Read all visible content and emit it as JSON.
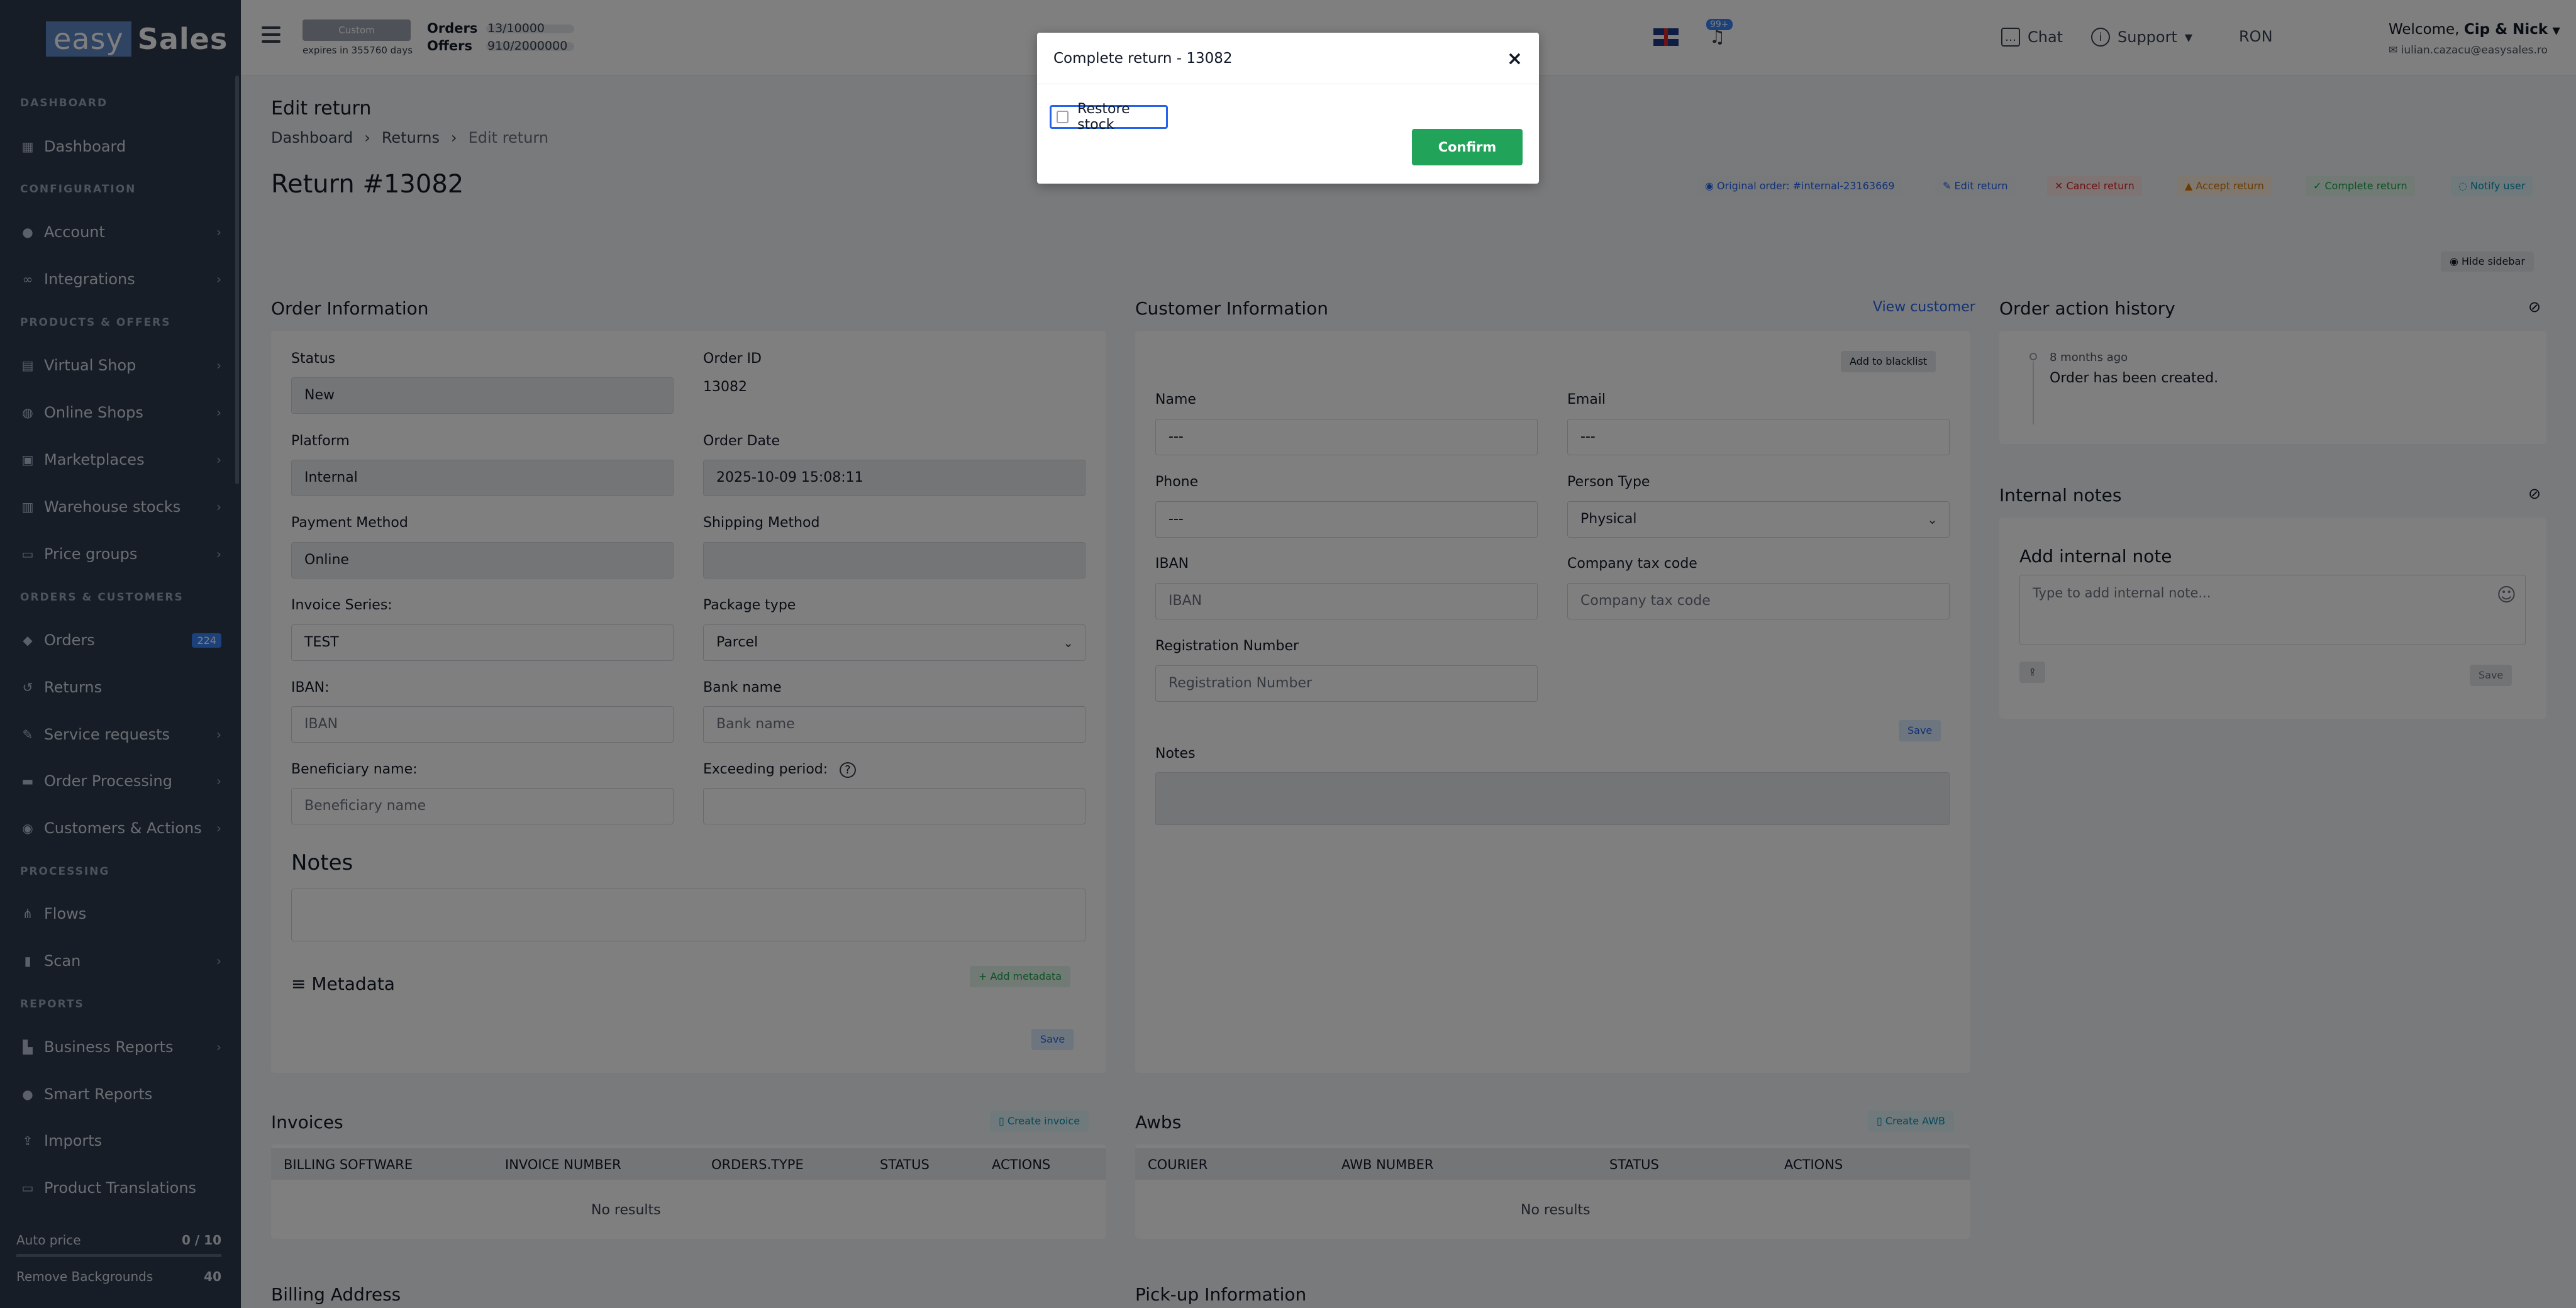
{
  "sidebar": {
    "logo": {
      "easy": "easy",
      "sales": "Sales"
    },
    "sections": {
      "dashboard": "DASHBOARD",
      "configuration": "CONFIGURATION",
      "products_offers": "PRODUCTS & OFFERS",
      "orders_customers": "ORDERS & CUSTOMERS",
      "processing": "PROCESSING",
      "reports": "REPORTS"
    },
    "items": {
      "dashboard": "Dashboard",
      "account": "Account",
      "integrations": "Integrations",
      "virtual_shop": "Virtual Shop",
      "online_shops": "Online Shops",
      "marketplaces": "Marketplaces",
      "warehouse_stocks": "Warehouse stocks",
      "price_groups": "Price groups",
      "orders": "Orders",
      "orders_badge": "224",
      "returns": "Returns",
      "service_requests": "Service requests",
      "order_processing": "Order Processing",
      "customers_actions": "Customers & Actions",
      "flows": "Flows",
      "scan": "Scan",
      "business_reports": "Business Reports",
      "smart_reports": "Smart Reports",
      "imports": "Imports",
      "product_translations": "Product Translations"
    },
    "usage": {
      "auto_price_label": "Auto price",
      "auto_price_value": "0 / 10",
      "auto_price_fraction": 0,
      "remove_bg_label": "Remove Backgrounds",
      "remove_bg_value": "40"
    }
  },
  "topbar": {
    "plan_badge": "Custom",
    "plan_expiry": "expires in 355760 days",
    "orders_label": "Orders",
    "orders_value": "13/10000",
    "offers_label": "Offers",
    "offers_value": "910/2000000",
    "chat": "Chat",
    "support": "Support",
    "currency": "RON",
    "notif_badge": "99+",
    "welcome_prefix": "Welcome,",
    "welcome_name": "Cip & Nick",
    "email": "iulian.cazacu@easysales.ro"
  },
  "page": {
    "title": "Edit return",
    "breadcrumb": [
      "Dashboard",
      "Returns",
      "Edit return"
    ],
    "return_title": "Return #13082",
    "actions": {
      "original_order": "Original order: #internal-23163669",
      "edit_return": "Edit return",
      "cancel_return": "Cancel return",
      "accept_return": "Accept return",
      "complete_return": "Complete return",
      "notify_user": "Notify user"
    },
    "hide_sidebar": "Hide sidebar"
  },
  "order_info": {
    "title": "Order Information",
    "status_label": "Status",
    "status_value": "New",
    "order_id_label": "Order ID",
    "order_id_value": "13082",
    "platform_label": "Platform",
    "platform_value": "Internal",
    "order_date_label": "Order Date",
    "order_date_value": "2025-10-09 15:08:11",
    "payment_label": "Payment Method",
    "payment_value": "Online",
    "shipping_label": "Shipping Method",
    "shipping_value": "",
    "invoice_series_label": "Invoice Series:",
    "invoice_series_value": "TEST",
    "package_label": "Package type",
    "package_value": "Parcel",
    "iban_label": "IBAN:",
    "iban_placeholder": "IBAN",
    "bank_label": "Bank name",
    "bank_placeholder": "Bank name",
    "beneficiary_label": "Beneficiary name:",
    "beneficiary_placeholder": "Beneficiary name",
    "exceeding_label": "Exceeding period:",
    "notes_title": "Notes",
    "metadata_title": "Metadata",
    "add_metadata": "+ Add metadata",
    "save": "Save"
  },
  "customer_info": {
    "title": "Customer Information",
    "view_customer": "View customer",
    "add_blacklist": "Add to blacklist",
    "name_label": "Name",
    "name_value": "---",
    "email_label": "Email",
    "email_value": "---",
    "phone_label": "Phone",
    "phone_value": "---",
    "person_type_label": "Person Type",
    "person_type_value": "Physical",
    "iban_label": "IBAN",
    "iban_placeholder": "IBAN",
    "tax_label": "Company tax code",
    "tax_placeholder": "Company tax code",
    "reg_label": "Registration Number",
    "reg_placeholder": "Registration Number",
    "save": "Save",
    "notes_label": "Notes"
  },
  "history": {
    "title": "Order action history",
    "time": "8 months ago",
    "event": "Order has been created."
  },
  "internal_notes": {
    "title": "Internal notes",
    "add_title": "Add internal note",
    "placeholder": "Type to add internal note...",
    "save": "Save"
  },
  "invoices": {
    "title": "Invoices",
    "create": "Create invoice",
    "columns": [
      "BILLING SOFTWARE",
      "INVOICE NUMBER",
      "ORDERS.TYPE",
      "STATUS",
      "ACTIONS"
    ],
    "empty": "No results"
  },
  "awbs": {
    "title": "Awbs",
    "create": "Create AWB",
    "columns": [
      "COURIER",
      "AWB NUMBER",
      "STATUS",
      "ACTIONS"
    ],
    "empty": "No results"
  },
  "billing_title": "Billing Address",
  "pickup_title": "Pick-up Information",
  "modal": {
    "title": "Complete return - 13082",
    "close": "×",
    "restore_stock": "Restore stock",
    "confirm": "Confirm"
  }
}
